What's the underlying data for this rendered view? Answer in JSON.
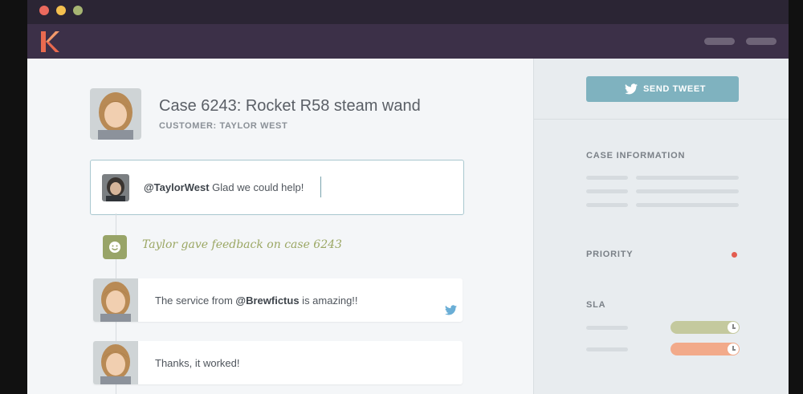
{
  "window": {
    "traffic_lights": [
      "close",
      "minimize",
      "maximize"
    ]
  },
  "app": {
    "logo_icon": "kustomer-k-logo"
  },
  "case": {
    "title": "Case 6243: Rocket R58 steam wand",
    "customer": "CUSTOMER: TAYLOR WEST"
  },
  "composer": {
    "mention": "@TaylorWest",
    "text": " Glad we could help!"
  },
  "timeline": {
    "feedback": "Taylor gave feedback on case 6243",
    "messages": [
      {
        "prefix": "The service from ",
        "mention": "@Brewfictus",
        "suffix": " is amazing!!",
        "channel_icon": "twitter-icon"
      },
      {
        "text": "Thanks, it worked!"
      }
    ]
  },
  "sidebar": {
    "send_tweet": "SEND TWEET",
    "case_information": "CASE INFORMATION",
    "priority": "PRIORITY",
    "sla": "SLA"
  },
  "colors": {
    "titlebar": "#2b2534",
    "appbar": "#3c3048",
    "accent": "#7fb2bf",
    "feedback": "#9ba764",
    "priority_dot": "#e35d50",
    "sla_green": "#c4c99e",
    "sla_orange": "#f2aa8a"
  }
}
